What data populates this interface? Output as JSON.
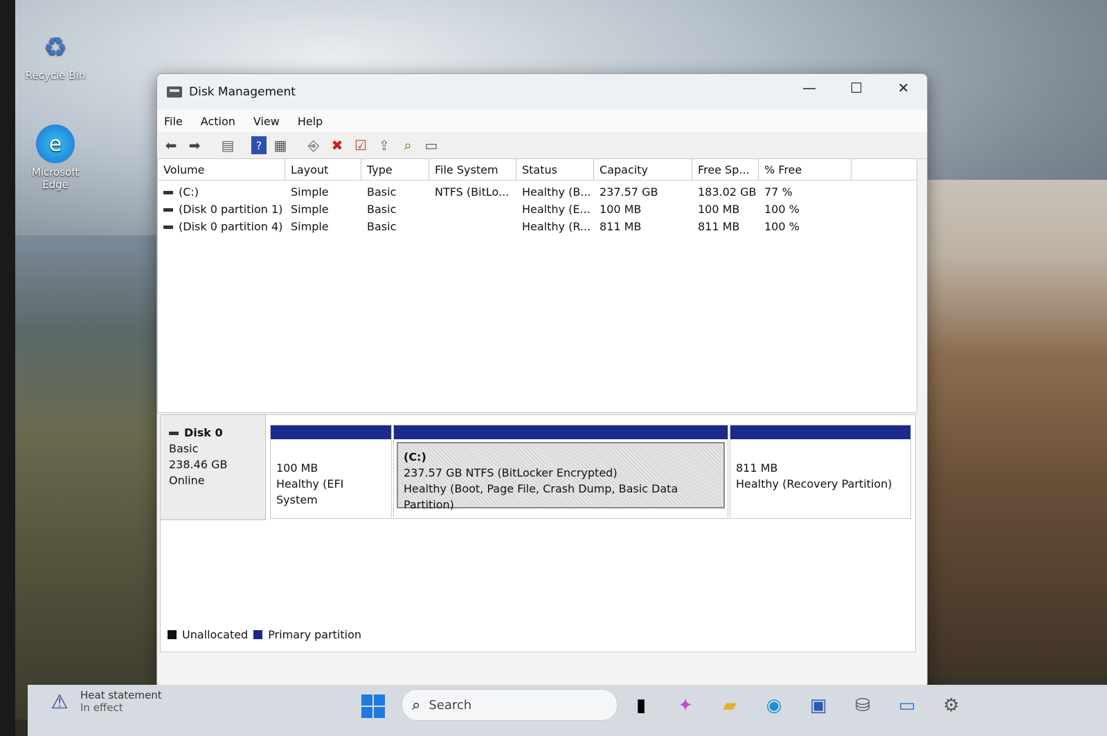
{
  "desktop": {
    "icons": [
      {
        "label": "Recycle Bin",
        "icon": "recycle-bin-icon"
      },
      {
        "label": "Microsoft Edge",
        "icon": "edge-icon"
      }
    ]
  },
  "window": {
    "title": "Disk Management",
    "controls": {
      "minimize": "—",
      "maximize": "☐",
      "close": "✕"
    },
    "menu": [
      "File",
      "Action",
      "View",
      "Help"
    ],
    "toolbar": [
      "back-icon",
      "forward-icon",
      "console-tree-icon",
      "help-icon",
      "properties-view-icon",
      "connect-icon",
      "delete-icon",
      "check-icon",
      "import-icon",
      "rescan-icon",
      "list-icon"
    ]
  },
  "volumes": {
    "columns": [
      "Volume",
      "Layout",
      "Type",
      "File System",
      "Status",
      "Capacity",
      "Free Sp...",
      "% Free"
    ],
    "rows": [
      {
        "volume": "(C:)",
        "layout": "Simple",
        "type": "Basic",
        "fs": "NTFS (BitLo...",
        "status": "Healthy (B...",
        "capacity": "237.57 GB",
        "free": "183.02 GB",
        "pct": "77 %"
      },
      {
        "volume": "(Disk 0 partition 1)",
        "layout": "Simple",
        "type": "Basic",
        "fs": "",
        "status": "Healthy (E...",
        "capacity": "100 MB",
        "free": "100 MB",
        "pct": "100 %"
      },
      {
        "volume": "(Disk 0 partition 4)",
        "layout": "Simple",
        "type": "Basic",
        "fs": "",
        "status": "Healthy (R...",
        "capacity": "811 MB",
        "free": "811 MB",
        "pct": "100 %"
      }
    ]
  },
  "disk": {
    "name": "Disk 0",
    "type": "Basic",
    "size": "238.46 GB",
    "state": "Online",
    "partitions": [
      {
        "title": "",
        "line1": "100 MB",
        "line2": "Healthy (EFI System"
      },
      {
        "title": "(C:)",
        "line1": "237.57 GB NTFS (BitLocker Encrypted)",
        "line2": "Healthy (Boot, Page File, Crash Dump, Basic Data Partition)"
      },
      {
        "title": "",
        "line1": "811 MB",
        "line2": "Healthy (Recovery Partition)"
      }
    ]
  },
  "legend": [
    {
      "label": "Unallocated",
      "color": "#111111"
    },
    {
      "label": "Primary partition",
      "color": "#1b2a8c"
    }
  ],
  "taskbar": {
    "weather_title": "Heat statement",
    "weather_sub": "In effect",
    "search_placeholder": "Search"
  }
}
